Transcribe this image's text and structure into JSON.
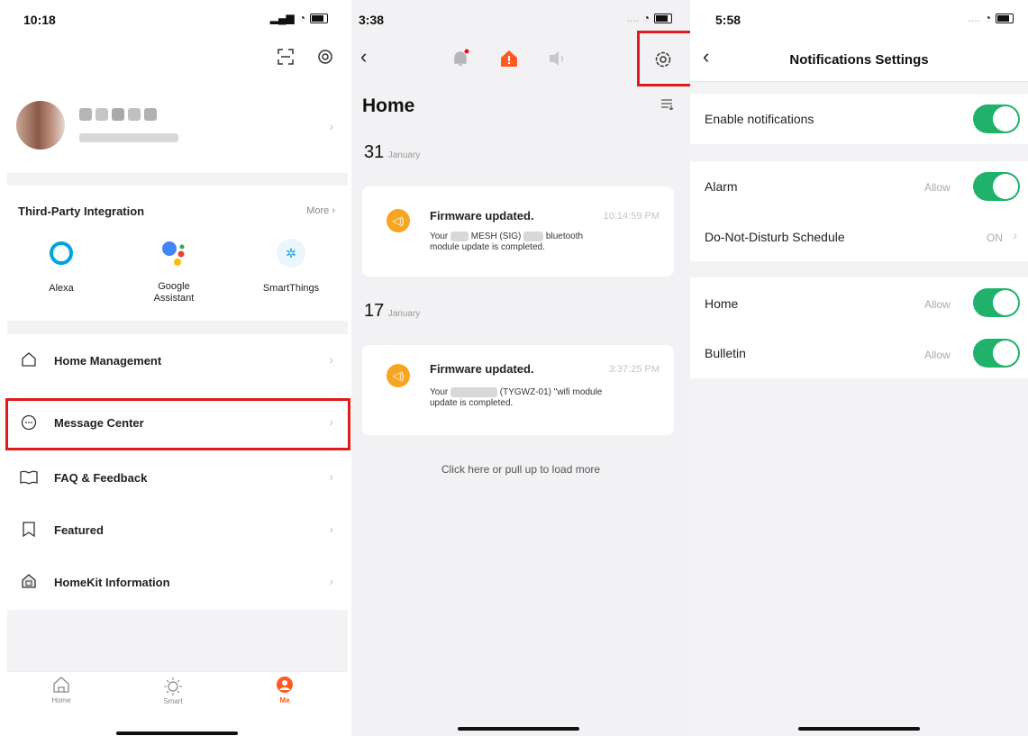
{
  "panel1": {
    "time": "10:18",
    "third_party": {
      "title": "Third-Party Integration",
      "more": "More",
      "items": [
        {
          "label": "Alexa"
        },
        {
          "label": "Google\nAssistant"
        },
        {
          "label": "SmartThings"
        }
      ]
    },
    "menu": [
      {
        "label": "Home Management",
        "icon": "house-outline-icon"
      },
      {
        "label": "Message Center",
        "icon": "chat-bubble-icon"
      },
      {
        "label": "FAQ & Feedback",
        "icon": "book-icon"
      },
      {
        "label": "Featured",
        "icon": "bookmark-icon"
      },
      {
        "label": "HomeKit Information",
        "icon": "homekit-icon"
      }
    ],
    "tabs": [
      {
        "label": "Home"
      },
      {
        "label": "Smart"
      },
      {
        "label": "Me"
      }
    ],
    "colors": {
      "accent": "#ff5a1f",
      "highlight": "#e01b1b"
    }
  },
  "panel2": {
    "time": "3:38",
    "title": "Home",
    "groups": [
      {
        "day": "31",
        "month": "January",
        "title": "Firmware updated.",
        "time": "10:14:59 PM",
        "body_line1_a": "Your",
        "body_line1_b": "MESH (SIG)",
        "body_line1_c": "bluetooth",
        "body_line2": "module update is completed."
      },
      {
        "day": "17",
        "month": "January",
        "title": "Firmware updated.",
        "time": "3:37:25 PM",
        "body_line1_a": "Your",
        "body_line1_b": "(TYGWZ-01) \"wifi module",
        "body_line2": "update is completed."
      }
    ],
    "load_more": "Click here or pull up to load more",
    "colors": {
      "notif_icon": "#f5a623"
    }
  },
  "panel3": {
    "time": "5:58",
    "title": "Notifications Settings",
    "enable_label": "Enable notifications",
    "alarm_label": "Alarm",
    "alarm_value": "Allow",
    "dnd_label": "Do-Not-Disturb Schedule",
    "dnd_value": "ON",
    "home_label": "Home",
    "home_value": "Allow",
    "bulletin_label": "Bulletin",
    "bulletin_value": "Allow",
    "colors": {
      "toggle_on": "#20b26a"
    }
  }
}
